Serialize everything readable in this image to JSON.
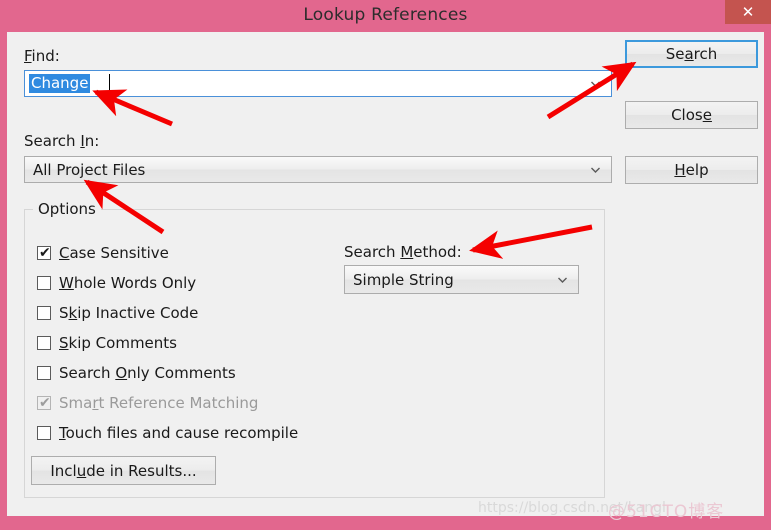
{
  "window": {
    "title": "Lookup References",
    "close_icon": "close-icon",
    "close_glyph": "✕"
  },
  "find": {
    "label_prefix": "F",
    "label_rest": "ind:",
    "value": "Change",
    "placeholder": "",
    "chevron_icon": "chevron-down-icon"
  },
  "search_in": {
    "label_a": "Search ",
    "label_acc": "I",
    "label_b": "n:",
    "value": "All Project Files",
    "chevron_icon": "chevron-down-icon"
  },
  "buttons": {
    "search": {
      "pre": "Se",
      "acc": "a",
      "post": "rch"
    },
    "close": {
      "pre": "Clos",
      "acc": "e",
      "post": ""
    },
    "help": {
      "pre": "",
      "acc": "H",
      "post": "elp"
    },
    "include_in_results": {
      "pre": "Incl",
      "acc": "u",
      "post": "de in Results..."
    }
  },
  "options": {
    "legend": "Options",
    "items": [
      {
        "pre": "",
        "acc": "C",
        "post": "ase Sensitive",
        "checked": true,
        "enabled": true
      },
      {
        "pre": "",
        "acc": "W",
        "post": "hole Words Only",
        "checked": false,
        "enabled": true
      },
      {
        "pre": "S",
        "acc": "k",
        "post": "ip Inactive Code",
        "checked": false,
        "enabled": true
      },
      {
        "pre": "",
        "acc": "S",
        "post": "kip Comments",
        "checked": false,
        "enabled": true
      },
      {
        "pre": "Search ",
        "acc": "O",
        "post": "nly Comments",
        "checked": false,
        "enabled": true
      },
      {
        "pre": "Sma",
        "acc": "r",
        "post": "t Reference Matching",
        "checked": true,
        "enabled": false
      },
      {
        "pre": "",
        "acc": "T",
        "post": "ouch files and cause recompile",
        "checked": false,
        "enabled": true
      }
    ],
    "check_glyph": "✔"
  },
  "search_method": {
    "label_a": "Search ",
    "label_acc": "M",
    "label_b": "ethod:",
    "value": "Simple String",
    "chevron_icon": "chevron-down-icon"
  },
  "annotations": {
    "arrow_color": "#f40000",
    "arrows": [
      {
        "name": "arrow-to-find-field"
      },
      {
        "name": "arrow-to-search-button"
      },
      {
        "name": "arrow-to-search-in-field"
      },
      {
        "name": "arrow-to-search-method-label"
      }
    ]
  },
  "watermark": {
    "url": "https://blog.csdn.net/kangl",
    "brand": "@51CTO博客"
  },
  "colors": {
    "title_bar": "#e2678e",
    "close_button": "#c4544f",
    "dialog_bg": "#f0f0f0",
    "focus_border": "#3c99dc",
    "selection": "#2f8ae0",
    "annotation_red": "#f40000"
  }
}
